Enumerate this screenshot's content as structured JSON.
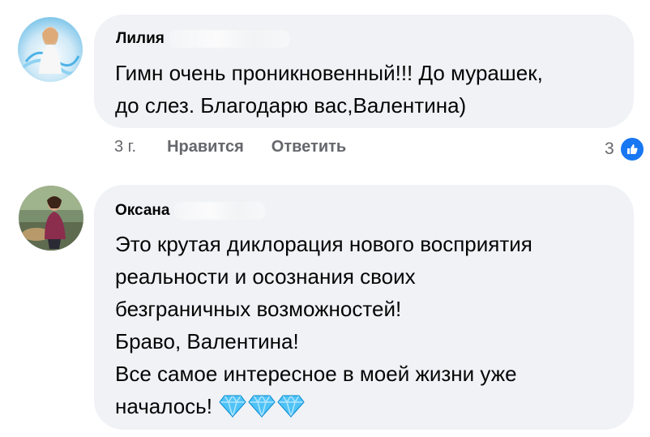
{
  "comments": [
    {
      "author": "Лилия",
      "text": "Гимн очень проникновенный!!! До мурашек,\nдо слез. Благодарю вас,Валентина)",
      "time": "3 г.",
      "like_label": "Нравится",
      "reply_label": "Ответить",
      "reaction_count": "3"
    },
    {
      "author": "Оксана",
      "text_main": "Это крутая диклорация нового восприятия\nреальности и осознания своих\nбезграничных возможностей!\n  Браво, Валентина!\nВсе самое интересное в моей жизни уже\nначалось!",
      "emoji": [
        "gem-icon",
        "gem-icon",
        "gem-icon"
      ]
    }
  ],
  "colors": {
    "bubble": "#f0f2f5",
    "meta_text": "#65676b",
    "like_blue": "#1877f2",
    "gem": "#4fc3f7"
  }
}
